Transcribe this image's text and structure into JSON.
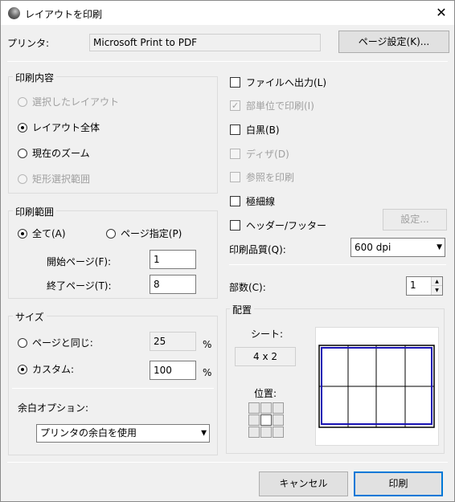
{
  "window": {
    "title": "レイアウトを印刷",
    "close_icon": "close-icon"
  },
  "printer": {
    "label": "プリンタ:",
    "value": "Microsoft Print to PDF",
    "page_setup_label": "ページ設定(K)..."
  },
  "print_content": {
    "legend": "印刷内容",
    "options": [
      {
        "label": "選択したレイアウト",
        "selected": false,
        "enabled": false
      },
      {
        "label": "レイアウト全体",
        "selected": true,
        "enabled": true
      },
      {
        "label": "現在のズーム",
        "selected": false,
        "enabled": true
      },
      {
        "label": "矩形選択範囲",
        "selected": false,
        "enabled": false
      }
    ]
  },
  "print_range": {
    "legend": "印刷範囲",
    "all_label": "全て(A)",
    "page_label": "ページ指定(P)",
    "start_label": "開始ページ(F):",
    "start_value": "1",
    "end_label": "終了ページ(T):",
    "end_value": "8"
  },
  "size": {
    "legend": "サイズ",
    "same_label": "ページと同じ:",
    "same_value": "25",
    "custom_label": "カスタム:",
    "custom_value": "100",
    "percent": "%",
    "margin_label": "余白オプション:",
    "margin_value": "プリンタの余白を使用"
  },
  "options": {
    "file_output": "ファイルへ出力(L)",
    "per_unit": "部単位で印刷(I)",
    "monochrome": "白黒(B)",
    "dither": "ディザ(D)",
    "print_refs": "参照を印刷",
    "hairline": "極細線",
    "header_footer": "ヘッダー/フッター",
    "settings_label": "設定..."
  },
  "quality": {
    "label": "印刷品質(Q):",
    "value": "600 dpi"
  },
  "copies": {
    "label": "部数(C):",
    "value": "1"
  },
  "arrangement": {
    "legend": "配置",
    "sheet_label": "シート:",
    "sheet_value": "4 x 2",
    "position_label": "位置:",
    "columns": 4,
    "rows": 2
  },
  "footer": {
    "cancel_label": "キャンセル",
    "print_label": "印刷"
  },
  "colors": {
    "accent": "#0078d7",
    "preview_border": "#1a14b4"
  }
}
